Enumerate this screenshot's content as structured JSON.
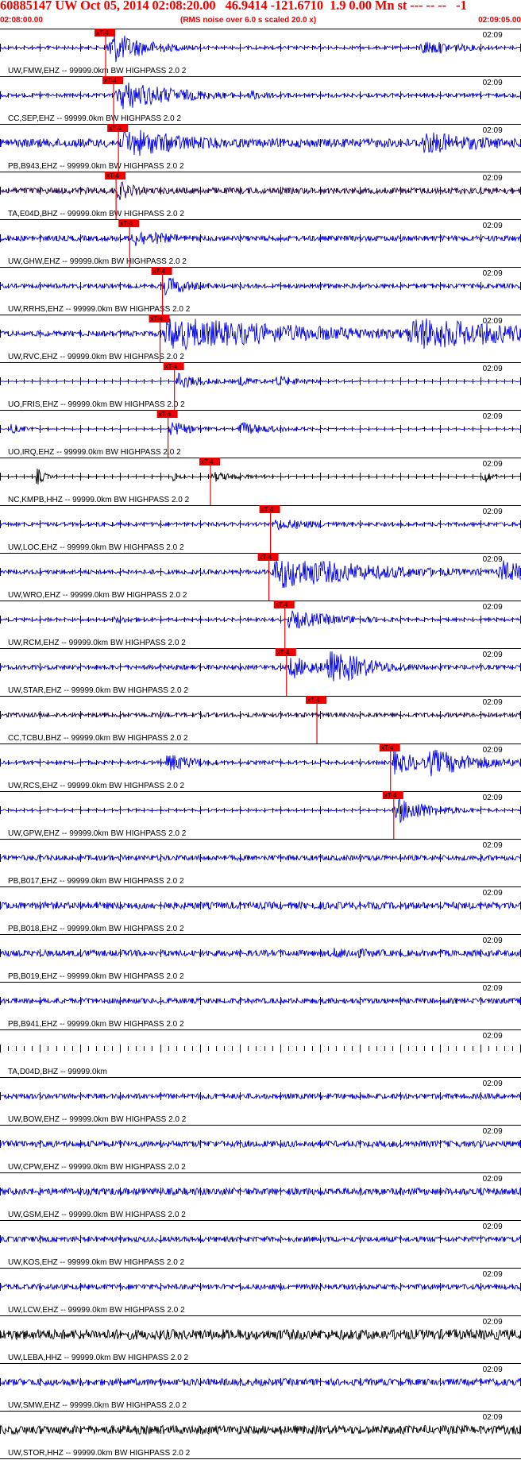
{
  "header": {
    "title": "60885147 UW Oct 05, 2014 02:08:20.00   46.9414 -121.6710  1.9 0.00 Mn st --- -- --   -1",
    "start_time": "02:08:00.00",
    "note": "(RMS noise over 6.0 s scaled 20.0 x)",
    "end_time": "02:09:05.00"
  },
  "colors": {
    "trace_default": "#0000ee",
    "trace_alt": "#000000",
    "trace_dark": "#220055",
    "pick_line": "#ee0000",
    "pick_label_bg": "#ee0000",
    "pick_label_text": "#000000",
    "header_text": "#ee0000",
    "divider": "#000000"
  },
  "chart_data": {
    "type": "seismogram_record_section",
    "x_start": "02:08:00.00",
    "x_end": "02:09:05.00",
    "x_range_seconds": [
      0,
      65
    ],
    "minute_marker": "02:09",
    "pick_label": "xT-4",
    "channels": [
      {
        "label": "UW,FMW,EHZ -- 99999.0km BW  HIGHPASS  2.0  2",
        "color": "blue",
        "pick_s": 13.2,
        "noise": 0.08,
        "bursts": [
          [
            13.2,
            0.6,
            1.0,
            5
          ],
          [
            52,
            0.9,
            0.45,
            6
          ]
        ]
      },
      {
        "label": "CC,SEP,EHZ -- 99999.0km BW  HIGHPASS  2.0  2",
        "color": "blue",
        "pick_s": 14.2,
        "noise": 0.1,
        "bursts": [
          [
            14.2,
            1.0,
            0.9,
            8
          ],
          [
            31,
            0.3,
            0.3,
            5
          ]
        ]
      },
      {
        "label": "PB,B943,EHZ -- 99999.0km BW  HIGHPASS  2.0  2",
        "color": "blue",
        "pick_s": 14.8,
        "noise": 0.25,
        "bursts": [
          [
            14.8,
            1.0,
            0.9,
            10
          ],
          [
            52,
            1.0,
            0.7,
            10
          ]
        ]
      },
      {
        "label": "TA,E04D,BHZ -- 99999.0km BW  HIGHPASS  2.0  2",
        "color": "dark",
        "pick_s": 14.5,
        "noise": 0.18,
        "bursts": [
          [
            14.5,
            0.25,
            0.6,
            3
          ]
        ]
      },
      {
        "label": "UW,GHW,EHZ -- 99999.0km BW  HIGHPASS  2.0  2",
        "color": "blue",
        "pick_s": 16.2,
        "noise": 0.15,
        "bursts": [
          [
            16.2,
            0.4,
            0.55,
            6
          ]
        ]
      },
      {
        "label": "UW,RRHS,EHZ -- 99999.0km BW  HIGHPASS  2.0  2",
        "color": "blue",
        "pick_s": 20.3,
        "noise": 0.12,
        "bursts": [
          [
            20.3,
            0.4,
            0.6,
            4
          ]
        ]
      },
      {
        "label": "UW,RVC,EHZ -- 99999.0km BW  HIGHPASS  2.0  2",
        "color": "blue",
        "pick_s": 20.0,
        "noise": 0.15,
        "bursts": [
          [
            20.0,
            1.0,
            1.0,
            22
          ],
          [
            50,
            2.0,
            1.0,
            18
          ]
        ]
      },
      {
        "label": "UO,FRIS,EHZ -- 99999.0km BW  HIGHPASS  2.0  2",
        "color": "blue",
        "pick_s": 21.8,
        "noise": 0.02,
        "bursts": [
          [
            21.8,
            0.3,
            0.5,
            4
          ],
          [
            29.5,
            0.5,
            0.3,
            3
          ],
          [
            34,
            0.6,
            0.35,
            4
          ]
        ]
      },
      {
        "label": "UO,IRQ,EHZ -- 99999.0km BW  HIGHPASS  2.0  2",
        "color": "blue",
        "pick_s": 21.0,
        "noise": 0.02,
        "bursts": [
          [
            1.2,
            0.2,
            0.3,
            2
          ],
          [
            21.0,
            0.3,
            0.5,
            3
          ],
          [
            29.5,
            0.6,
            0.4,
            5
          ]
        ]
      },
      {
        "label": "NC,KMPB,HHZ -- 99999.0km BW  HIGHPASS  2.0  2",
        "color": "black",
        "pick_s": 26.3,
        "noise": 0.03,
        "bursts": [
          [
            4.5,
            0.08,
            0.6,
            1
          ],
          [
            21.5,
            0.08,
            0.3,
            1
          ],
          [
            26.3,
            0.3,
            0.3,
            4
          ],
          [
            60.3,
            0.1,
            0.55,
            1
          ]
        ]
      },
      {
        "label": "UW,LOC,EHZ -- 99999.0km BW  HIGHPASS  2.0  2",
        "color": "blue",
        "pick_s": 33.8,
        "noise": 0.1,
        "bursts": [
          [
            33.8,
            0.6,
            0.35,
            8
          ]
        ]
      },
      {
        "label": "UW,WRO,EHZ -- 99999.0km BW  HIGHPASS  2.0  2",
        "color": "blue",
        "pick_s": 33.6,
        "noise": 0.12,
        "bursts": [
          [
            33.6,
            1.2,
            1.0,
            14
          ],
          [
            62,
            0.6,
            0.7,
            6
          ]
        ]
      },
      {
        "label": "UW,RCM,EHZ -- 99999.0km BW  HIGHPASS  2.0  2",
        "color": "blue",
        "pick_s": 35.6,
        "noise": 0.08,
        "bursts": [
          [
            35.6,
            0.6,
            0.55,
            8
          ],
          [
            14,
            0.3,
            0.2,
            6
          ]
        ]
      },
      {
        "label": "UW,STAR,EHZ -- 99999.0km BW  HIGHPASS  2.0  2",
        "color": "blue",
        "pick_s": 35.8,
        "noise": 0.12,
        "bursts": [
          [
            35.8,
            0.6,
            0.7,
            4
          ],
          [
            40.5,
            0.5,
            1.0,
            6
          ],
          [
            43,
            0.5,
            0.8,
            5
          ]
        ]
      },
      {
        "label": "CC,TCBU,BHZ -- 99999.0km BW  HIGHPASS  2.0  2",
        "color": "dark",
        "pick_s": 39.6,
        "noise": 0.12,
        "bursts": []
      },
      {
        "label": "UW,RCS,EHZ -- 99999.0km BW  HIGHPASS  2.0  2",
        "color": "blue",
        "pick_s": 48.8,
        "noise": 0.1,
        "bursts": [
          [
            20.5,
            0.5,
            0.6,
            4
          ],
          [
            48.8,
            0.4,
            0.7,
            5
          ],
          [
            53,
            0.8,
            0.8,
            8
          ]
        ]
      },
      {
        "label": "UW,GPW,EHZ -- 99999.0km BW  HIGHPASS  2.0  2",
        "color": "blue",
        "pick_s": 49.2,
        "noise": 0.05,
        "bursts": [
          [
            49.2,
            0.4,
            0.8,
            5
          ]
        ]
      },
      {
        "label": "PB,B017,EHZ -- 99999.0km BW  HIGHPASS  2.0  2",
        "color": "blue",
        "noise": 0.15,
        "bursts": []
      },
      {
        "label": "PB,B018,EHZ -- 99999.0km BW  HIGHPASS  2.0  2",
        "color": "blue",
        "noise": 0.2,
        "bursts": []
      },
      {
        "label": "PB,B019,EHZ -- 99999.0km BW  HIGHPASS  2.0  2",
        "color": "blue",
        "noise": 0.18,
        "bursts": [
          [
            40,
            2.0,
            0.35,
            10
          ]
        ]
      },
      {
        "label": "PB,B941,EHZ -- 99999.0km BW  HIGHPASS  2.0  2",
        "color": "blue",
        "noise": 0.15,
        "bursts": []
      },
      {
        "label": "TA,D04D,BHZ -- 99999.0km",
        "color": "blue",
        "noise": 0,
        "bursts": []
      },
      {
        "label": "UW,BOW,EHZ -- 99999.0km BW  HIGHPASS  2.0  2",
        "color": "blue",
        "noise": 0.15,
        "bursts": []
      },
      {
        "label": "UW,CPW,EHZ -- 99999.0km BW  HIGHPASS  2.0  2",
        "color": "blue",
        "noise": 0.18,
        "bursts": []
      },
      {
        "label": "UW,GSM,EHZ -- 99999.0km BW  HIGHPASS  2.0  2",
        "color": "blue",
        "noise": 0.2,
        "bursts": []
      },
      {
        "label": "UW,KOS,EHZ -- 99999.0km BW  HIGHPASS  2.0  2",
        "color": "blue",
        "noise": 0.15,
        "bursts": []
      },
      {
        "label": "UW,LCW,EHZ -- 99999.0km BW  HIGHPASS  2.0  2",
        "color": "blue",
        "noise": 0.15,
        "bursts": []
      },
      {
        "label": "UW,LEBA,HHZ -- 99999.0km BW  HIGHPASS  2.0  2",
        "color": "black",
        "noise": 0.3,
        "bursts": []
      },
      {
        "label": "UW,SMW,EHZ -- 99999.0km BW  HIGHPASS  2.0  2",
        "color": "blue",
        "noise": 0.2,
        "bursts": []
      },
      {
        "label": "UW,STOR,HHZ -- 99999.0km BW  HIGHPASS  2.0  2",
        "color": "black",
        "noise": 0.25,
        "bursts": []
      }
    ]
  }
}
